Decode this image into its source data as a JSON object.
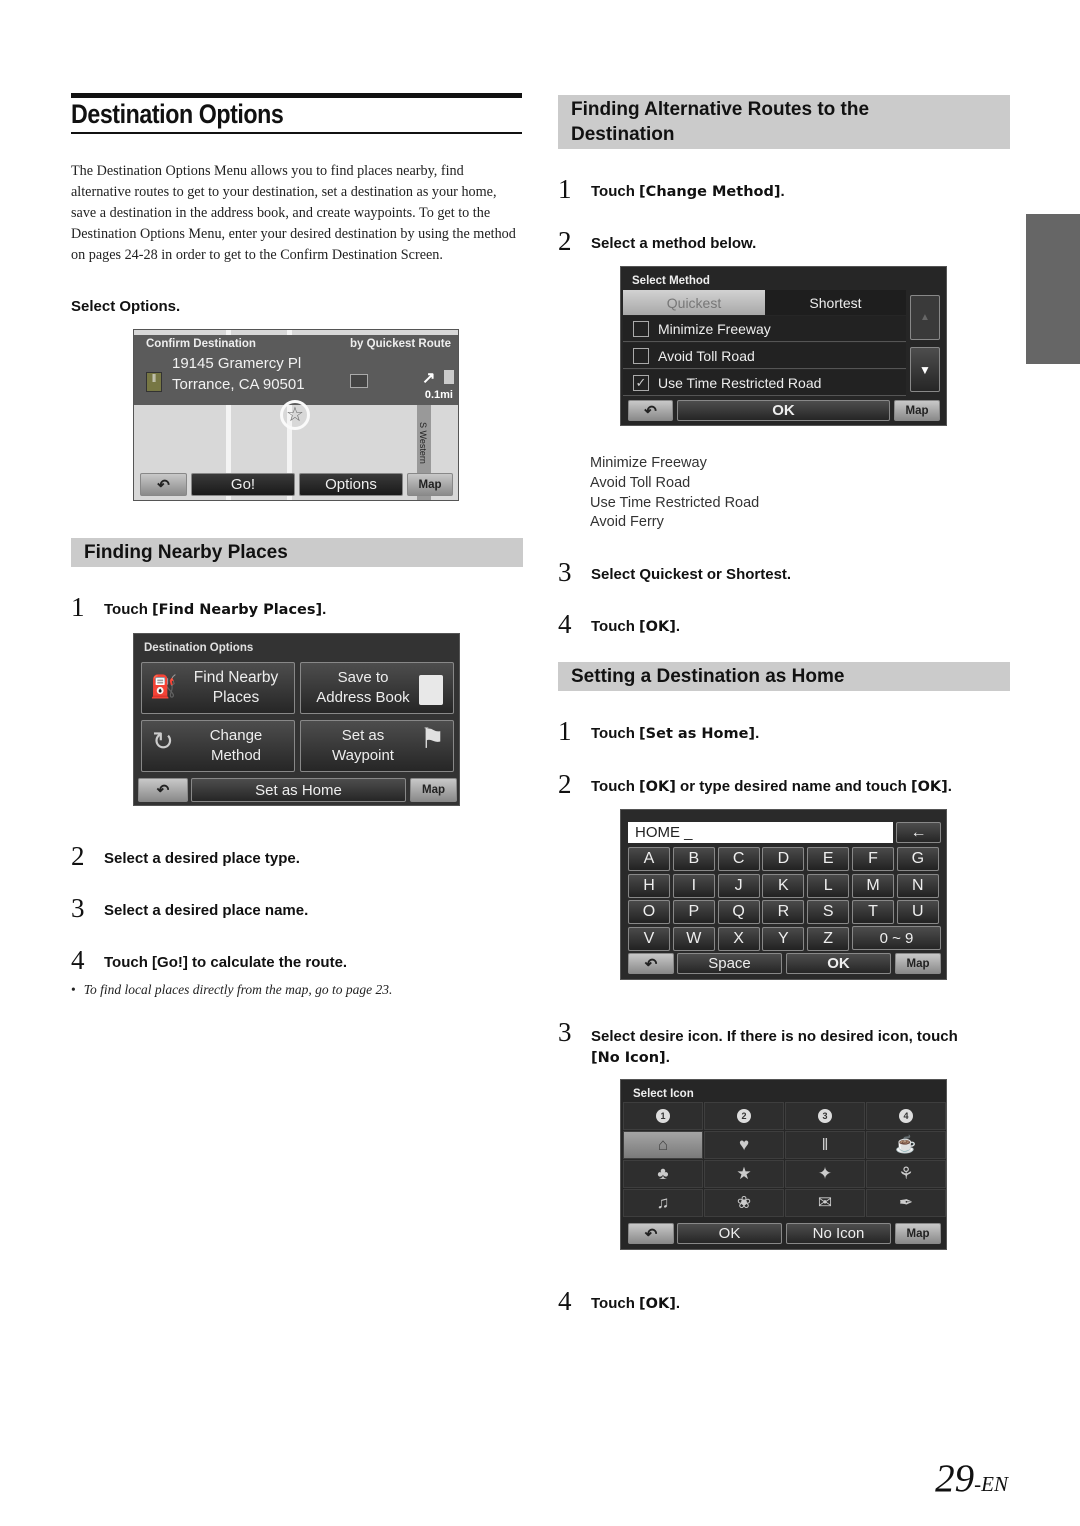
{
  "page": {
    "title": "Destination Options",
    "intro": "The Destination Options Menu allows you to find places nearby, find alternative routes to get to your destination, set a destination as your home, save a destination in the address book, and create waypoints. To get to the Destination Options Menu, enter your desired destination by using the method on pages 24-28 in order to get to the Confirm Destination Screen.",
    "select_options": "Select Options.",
    "page_number": "29",
    "page_suffix": "-EN"
  },
  "confirm_screen": {
    "header_left": "Confirm Destination",
    "header_right": "by Quickest Route",
    "address_line1": "19145 Gramercy Pl",
    "address_line2": "Torrance, CA 90501",
    "distance": "0.1mi",
    "street_label": "S Western",
    "buttons": {
      "back": "⮌",
      "go": "Go!",
      "options": "Options",
      "map": "Map"
    }
  },
  "nearby": {
    "heading": "Finding Nearby Places",
    "steps": [
      {
        "num": "1",
        "pre": "Touch ",
        "kw": "[Find Nearby Places]",
        "post": "."
      },
      {
        "num": "2",
        "text": "Select a desired place type."
      },
      {
        "num": "3",
        "text": "Select a desired place name."
      },
      {
        "num": "4",
        "pre": "Touch ",
        "kw": "[Go!]",
        "post": " to calculate the route."
      }
    ],
    "note": "To find local places directly from the map, go to page 23."
  },
  "options_screen": {
    "header": "Destination Options",
    "buttons": {
      "find_nearby_1": "Find Nearby",
      "find_nearby_2": "Places",
      "save_1": "Save to",
      "save_2": "Address Book",
      "change_1": "Change",
      "change_2": "Method",
      "waypoint_1": "Set as",
      "waypoint_2": "Waypoint",
      "set_home": "Set as Home",
      "map": "Map"
    }
  },
  "alt_routes": {
    "heading_line1": "Finding Alternative Routes to the",
    "heading_line2": "Destination",
    "steps": [
      {
        "num": "1",
        "pre": "Touch ",
        "kw": "[Change Method]",
        "post": "."
      },
      {
        "num": "2",
        "text": "Select a method below."
      },
      {
        "num": "3",
        "text": "Select Quickest or Shortest."
      },
      {
        "num": "4",
        "pre": "Touch ",
        "kw": "[OK]",
        "post": "."
      }
    ],
    "methods": [
      "Minimize Freeway",
      "Avoid Toll Road",
      "Use Time Restricted Road",
      "Avoid Ferry"
    ]
  },
  "method_screen": {
    "header": "Select Method",
    "tab_quickest": "Quickest",
    "tab_shortest": "Shortest",
    "options": [
      {
        "label": "Minimize Freeway",
        "checked": false
      },
      {
        "label": "Avoid Toll Road",
        "checked": false
      },
      {
        "label": "Use Time Restricted Road",
        "checked": true
      }
    ],
    "ok": "OK",
    "map": "Map"
  },
  "home": {
    "heading": "Setting a Destination as Home",
    "steps": [
      {
        "num": "1",
        "pre": "Touch ",
        "kw": "[Set as Home]",
        "post": "."
      },
      {
        "num": "2",
        "pre": "Touch ",
        "kw": "[OK]",
        "mid": " or type desired name and touch ",
        "kw2": "[OK]",
        "post": "."
      },
      {
        "num": "3",
        "text": "Select desire icon. If there is no desired icon, touch",
        "kw": "[No Icon]",
        "post": "."
      },
      {
        "num": "4",
        "pre": "Touch ",
        "kw": "[OK]",
        "post": "."
      }
    ]
  },
  "keyboard_screen": {
    "input_value": "HOME _",
    "rows": [
      [
        "A",
        "B",
        "C",
        "D",
        "E",
        "F",
        "G"
      ],
      [
        "H",
        "I",
        "J",
        "K",
        "L",
        "M",
        "N"
      ],
      [
        "O",
        "P",
        "Q",
        "R",
        "S",
        "T",
        "U"
      ],
      [
        "V",
        "W",
        "X",
        "Y",
        "Z"
      ]
    ],
    "num_key": "0 ~ 9",
    "space": "Space",
    "ok": "OK",
    "map": "Map"
  },
  "icon_screen": {
    "header": "Select Icon",
    "pins": [
      "1",
      "2",
      "3",
      "4"
    ],
    "icons_row2": [
      "⌂",
      "♥",
      "‖",
      "☕"
    ],
    "icons_row3": [
      "♣",
      "★",
      "✦",
      "⚘"
    ],
    "icons_row4": [
      "♫",
      "❀",
      "✉",
      "✒"
    ],
    "ok": "OK",
    "no_icon": "No Icon",
    "map": "Map"
  }
}
